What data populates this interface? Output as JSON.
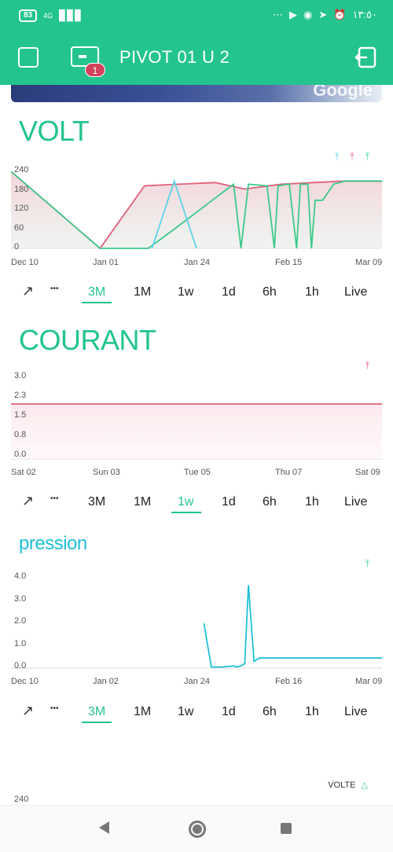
{
  "status": {
    "battery": "83",
    "net": "4G",
    "time": "١٣:٥٠",
    "dots": "⋯"
  },
  "header": {
    "title": "PIVOT 01 U 2",
    "badge": "1"
  },
  "map": {
    "brand": "Google"
  },
  "widgets": {
    "volt": {
      "title": "VOLT",
      "yticks": [
        "240",
        "180",
        "120",
        "60",
        "0"
      ],
      "xticks": [
        "Dec 10",
        "Jan 01",
        "Jan 24",
        "Feb 15",
        "Mar 09"
      ],
      "legend_colors": [
        "#5bd3e8",
        "#e0607a",
        "#3cc98a"
      ],
      "chart_data": {
        "type": "line",
        "ylim": [
          0,
          240
        ],
        "x": [
          "Dec 10",
          "Jan 01",
          "Jan 24",
          "Feb 15",
          "Mar 09"
        ],
        "series": [
          {
            "color": "#e0607a",
            "fill": true,
            "points": [
              [
                0,
                240
              ],
              [
                0.24,
                0
              ],
              [
                0.36,
                195
              ],
              [
                0.55,
                205
              ],
              [
                0.63,
                185
              ],
              [
                0.73,
                200
              ],
              [
                0.9,
                210
              ],
              [
                1.0,
                210
              ]
            ]
          },
          {
            "color": "#3cc98a",
            "fill": false,
            "points": [
              [
                0,
                240
              ],
              [
                0.24,
                0
              ],
              [
                0.37,
                0
              ],
              [
                0.44,
                60
              ],
              [
                0.6,
                200
              ],
              [
                0.62,
                0
              ],
              [
                0.64,
                200
              ],
              [
                0.69,
                195
              ],
              [
                0.71,
                0
              ],
              [
                0.72,
                195
              ],
              [
                0.75,
                200
              ],
              [
                0.77,
                0
              ],
              [
                0.78,
                200
              ],
              [
                0.8,
                200
              ],
              [
                0.81,
                0
              ],
              [
                0.82,
                150
              ],
              [
                0.84,
                150
              ],
              [
                0.87,
                200
              ],
              [
                0.9,
                210
              ],
              [
                1.0,
                210
              ]
            ]
          },
          {
            "color": "#5bd3e8",
            "fill": false,
            "points": [
              [
                0.38,
                0
              ],
              [
                0.44,
                210
              ],
              [
                0.5,
                0
              ]
            ]
          }
        ]
      }
    },
    "courant": {
      "title": "COURANT",
      "yticks": [
        "3.0",
        "2.3",
        "1.5",
        "0.8",
        "0.0"
      ],
      "xticks": [
        "Sat 02",
        "Sun 03",
        "Tue 05",
        "Thu 07",
        "Sat 09"
      ],
      "legend_colors": [
        "#e0607a"
      ],
      "chart_data": {
        "type": "area",
        "ylim": [
          0,
          3.0
        ],
        "x": [
          "Sat 02",
          "Sun 03",
          "Tue 05",
          "Thu 07",
          "Sat 09"
        ],
        "series": [
          {
            "color": "#e0607a",
            "fill": true,
            "points": [
              [
                0,
                2.1
              ],
              [
                1.0,
                2.1
              ]
            ]
          }
        ]
      }
    },
    "pression": {
      "title": "pression",
      "yticks": [
        "4.0",
        "3.0",
        "2.0",
        "1.0",
        "0.0"
      ],
      "xticks": [
        "Dec 10",
        "Jan 02",
        "Jan 24",
        "Feb 16",
        "Mar 09"
      ],
      "legend_colors": [
        "#3cc98a"
      ],
      "chart_data": {
        "type": "line",
        "ylim": [
          0,
          4.0
        ],
        "x": [
          "Dec 10",
          "Jan 02",
          "Jan 24",
          "Feb 16",
          "Mar 09"
        ],
        "series": [
          {
            "color": "#1fc0d8",
            "fill": false,
            "points": [
              [
                0.52,
                2.0
              ],
              [
                0.54,
                0.05
              ],
              [
                0.57,
                0.05
              ],
              [
                0.6,
                0.1
              ],
              [
                0.61,
                0.05
              ],
              [
                0.62,
                0.1
              ],
              [
                0.63,
                0.2
              ],
              [
                0.64,
                3.7
              ],
              [
                0.655,
                0.3
              ],
              [
                0.67,
                0.45
              ],
              [
                1.0,
                0.45
              ]
            ]
          }
        ]
      }
    },
    "bottom": {
      "legend": "VOLTE",
      "ytick": "240"
    }
  },
  "ranges": [
    "3M",
    "1M",
    "1w",
    "1d",
    "6h",
    "1h",
    "Live"
  ],
  "range_selected": {
    "volt": "3M",
    "courant": "1w",
    "pression": "3M"
  },
  "controls": {
    "expand": "↗",
    "more": "•••"
  }
}
